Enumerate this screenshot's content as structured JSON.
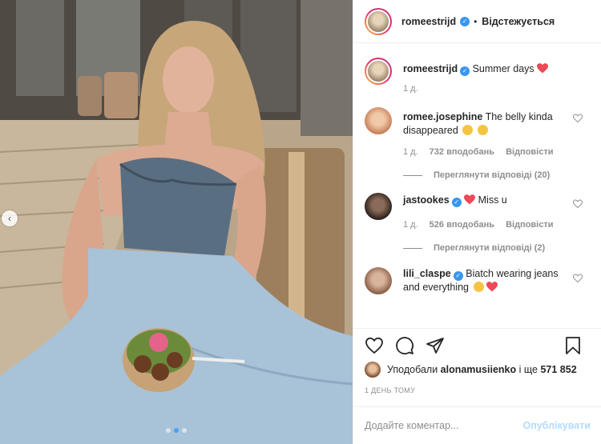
{
  "post": {
    "author": "romeestrijd",
    "follow_separator": "•",
    "follow_label": "Відстежується",
    "caption": "Summer days",
    "caption_time": "1 д."
  },
  "comments": [
    {
      "user": "romee.josephine",
      "verified": false,
      "text": "The belly kinda disappeared",
      "time": "1 д.",
      "likes": "732 вподобань",
      "reply": "Відповісти",
      "view_replies": "Переглянути відповіді (20)"
    },
    {
      "user": "jastookes",
      "verified": true,
      "text": "Miss u",
      "time": "1 д.",
      "likes": "526 вподобань",
      "reply": "Відповісти",
      "view_replies": "Переглянути відповіді (2)"
    },
    {
      "user": "lili_claspe",
      "verified": true,
      "text": "Biatch wearing jeans and everything",
      "time": "",
      "likes": "",
      "reply": "",
      "view_replies": ""
    }
  ],
  "likes": {
    "prefix": "Уподобали",
    "user": "alonamusiienko",
    "middle": "і ще",
    "count": "571 852"
  },
  "time_ago": "1 ДЕНЬ ТОМУ",
  "comment_input": {
    "placeholder": "Додайте коментар...",
    "post_label": "Опублікувати"
  },
  "photo": {
    "current_slide": 2,
    "total_slides": 3
  },
  "colors": {
    "accent": "#3897f0",
    "heart": "#ed4956",
    "post_disabled": "#b3dbff",
    "muted": "#8e8e8e"
  }
}
